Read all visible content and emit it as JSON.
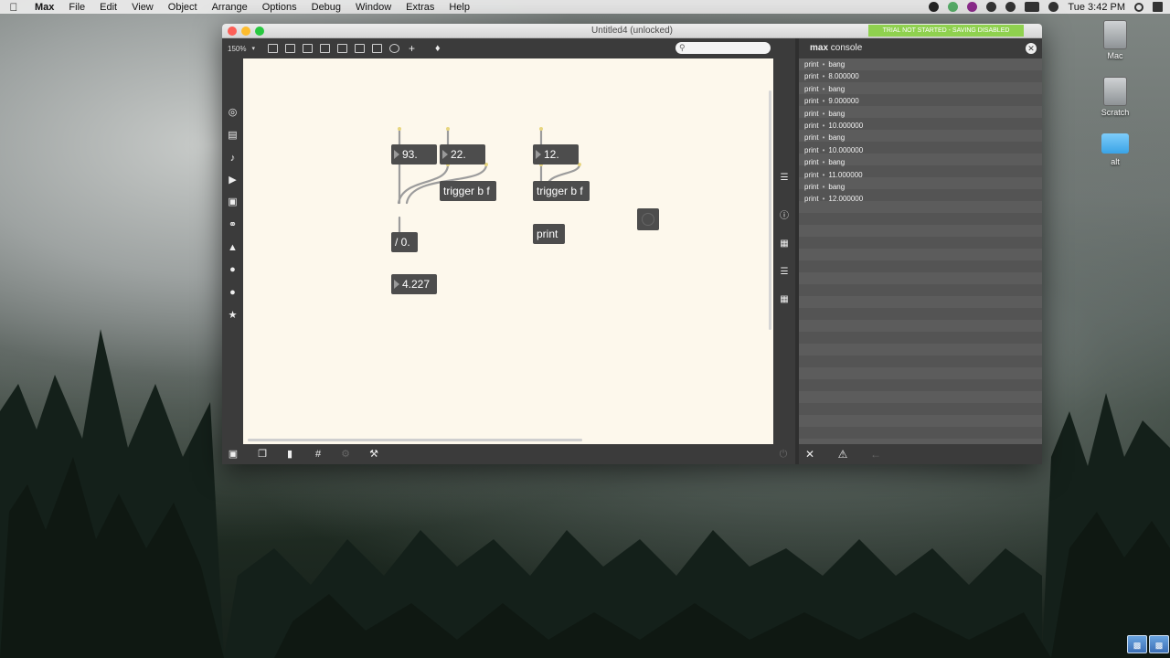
{
  "menubar": {
    "apple": "",
    "app_name": "Max",
    "items": [
      "File",
      "Edit",
      "View",
      "Object",
      "Arrange",
      "Options",
      "Debug",
      "Window",
      "Extras",
      "Help"
    ],
    "clock": "Tue 3:42 PM"
  },
  "desktop": {
    "icons": [
      {
        "label": "Mac"
      },
      {
        "label": "Scratch"
      },
      {
        "label": "alt"
      }
    ]
  },
  "window": {
    "title": "Untitled4 (unlocked)",
    "trial_banner": "TRIAL NOT STARTED - SAVING DISABLED",
    "zoom": "150%",
    "search_placeholder": ""
  },
  "patch": {
    "objects": [
      {
        "id": "num1",
        "text": "93."
      },
      {
        "id": "num2",
        "text": "22."
      },
      {
        "id": "trig1",
        "text": "trigger b f"
      },
      {
        "id": "div",
        "text": "/ 0."
      },
      {
        "id": "result",
        "text": "4.227"
      },
      {
        "id": "num3",
        "text": "12."
      },
      {
        "id": "trig2",
        "text": "trigger b f"
      },
      {
        "id": "print",
        "text": "print"
      }
    ]
  },
  "console": {
    "title_bold": "max",
    "title_rest": "console",
    "rows": [
      {
        "source": "print",
        "message": "bang"
      },
      {
        "source": "print",
        "message": "8.000000"
      },
      {
        "source": "print",
        "message": "bang"
      },
      {
        "source": "print",
        "message": "9.000000"
      },
      {
        "source": "print",
        "message": "bang"
      },
      {
        "source": "print",
        "message": "10.000000"
      },
      {
        "source": "print",
        "message": "bang"
      },
      {
        "source": "print",
        "message": "10.000000"
      },
      {
        "source": "print",
        "message": "bang"
      },
      {
        "source": "print",
        "message": "11.000000"
      },
      {
        "source": "print",
        "message": "bang"
      },
      {
        "source": "print",
        "message": "12.000000"
      }
    ]
  },
  "colors": {
    "canvas_bg": "#fdf8ec",
    "object_bg": "#4d4d4d",
    "trial_banner": "#8fd14f",
    "console_bg": "#5a5a5a"
  }
}
